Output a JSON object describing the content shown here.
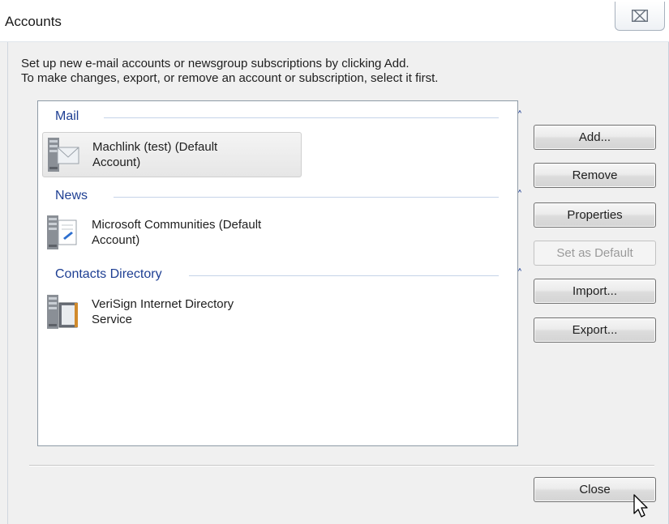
{
  "window": {
    "title": "Accounts",
    "close_glyph": "⌧"
  },
  "instructions": {
    "line1": "Set up new e-mail accounts or newsgroup subscriptions by clicking Add.",
    "line2": "To make changes, export, or remove an account or subscription, select it first."
  },
  "groups": [
    {
      "label": "Mail",
      "chevron": "˄",
      "accounts": [
        {
          "name_line1": "Machlink (test) (Default",
          "name_line2": "Account)",
          "icon": "mail-server-icon",
          "selected": true
        }
      ]
    },
    {
      "label": "News",
      "chevron": "˄",
      "accounts": [
        {
          "name_line1": "Microsoft Communities (Default",
          "name_line2": "Account)",
          "icon": "news-server-icon",
          "selected": false
        }
      ]
    },
    {
      "label": "Contacts Directory",
      "chevron": "˄",
      "accounts": [
        {
          "name_line1": "VeriSign Internet Directory",
          "name_line2": "Service",
          "icon": "directory-server-icon",
          "selected": false
        }
      ]
    }
  ],
  "buttons": {
    "add": "Add...",
    "remove": "Remove",
    "properties": "Properties",
    "set_default": "Set as Default",
    "import": "Import...",
    "export": "Export...",
    "close": "Close"
  },
  "colors": {
    "group_header": "#1e3f93",
    "selection": "#e6e6e6"
  }
}
